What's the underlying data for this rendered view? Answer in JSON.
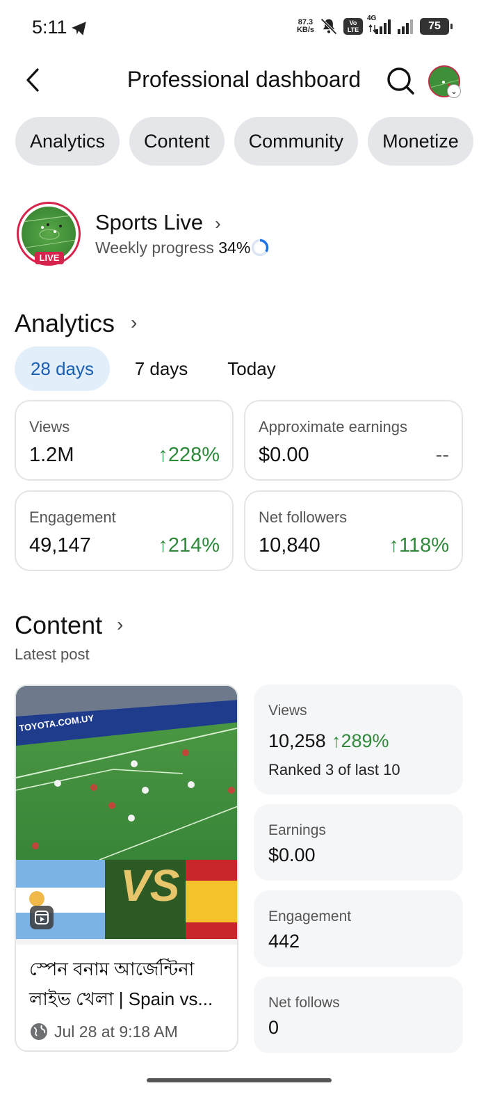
{
  "status_bar": {
    "time": "5:11",
    "net_speed_value": "87.3",
    "net_speed_unit": "KB/s",
    "volte_label": "Vo LTE",
    "network_type": "4G",
    "battery": "75"
  },
  "header": {
    "title": "Professional dashboard"
  },
  "tabs": [
    {
      "label": "Analytics"
    },
    {
      "label": "Content"
    },
    {
      "label": "Community"
    },
    {
      "label": "Monetize"
    }
  ],
  "profile": {
    "name": "Sports Live",
    "live_badge": "LIVE",
    "weekly_label": "Weekly progress",
    "weekly_value": "34%",
    "weekly_fraction": 0.34
  },
  "analytics": {
    "title": "Analytics",
    "ranges": [
      {
        "label": "28 days",
        "active": true
      },
      {
        "label": "7 days",
        "active": false
      },
      {
        "label": "Today",
        "active": false
      }
    ],
    "cards": [
      {
        "label": "Views",
        "value": "1.2M",
        "delta": "228%"
      },
      {
        "label": "Approximate earnings",
        "value": "$0.00",
        "delta": "--"
      },
      {
        "label": "Engagement",
        "value": "49,147",
        "delta": "214%"
      },
      {
        "label": "Net followers",
        "value": "10,840",
        "delta": "118%"
      }
    ],
    "accent_up": "#2e8a3a"
  },
  "content": {
    "title": "Content",
    "subtitle": "Latest post",
    "post": {
      "title": "স্পেন বনাম আর্জেন্টিনা লাইভ খেলা | Spain vs...",
      "date": "Jul 28 at 9:18 AM",
      "thumb_vs": "VS",
      "thumb_banner": "TOYOTA.COM.UY"
    },
    "stats": {
      "views_label": "Views",
      "views_value": "10,258",
      "views_delta": "289%",
      "views_rank": "Ranked 3 of last 10",
      "earnings_label": "Earnings",
      "earnings_value": "$0.00",
      "engagement_label": "Engagement",
      "engagement_value": "442",
      "follows_label": "Net follows",
      "follows_value": "0"
    }
  }
}
